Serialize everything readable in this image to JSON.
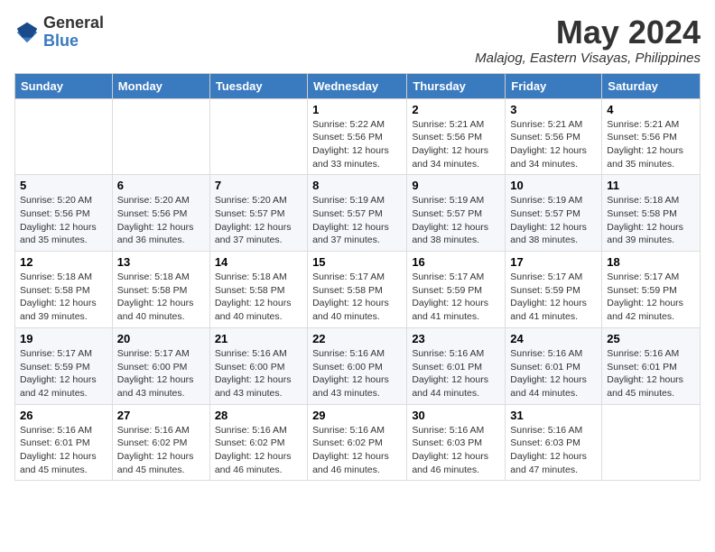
{
  "logo": {
    "general": "General",
    "blue": "Blue"
  },
  "title": {
    "month": "May 2024",
    "location": "Malajog, Eastern Visayas, Philippines"
  },
  "days_of_week": [
    "Sunday",
    "Monday",
    "Tuesday",
    "Wednesday",
    "Thursday",
    "Friday",
    "Saturday"
  ],
  "weeks": [
    [
      {
        "day": "",
        "info": ""
      },
      {
        "day": "",
        "info": ""
      },
      {
        "day": "",
        "info": ""
      },
      {
        "day": "1",
        "info": "Sunrise: 5:22 AM\nSunset: 5:56 PM\nDaylight: 12 hours\nand 33 minutes."
      },
      {
        "day": "2",
        "info": "Sunrise: 5:21 AM\nSunset: 5:56 PM\nDaylight: 12 hours\nand 34 minutes."
      },
      {
        "day": "3",
        "info": "Sunrise: 5:21 AM\nSunset: 5:56 PM\nDaylight: 12 hours\nand 34 minutes."
      },
      {
        "day": "4",
        "info": "Sunrise: 5:21 AM\nSunset: 5:56 PM\nDaylight: 12 hours\nand 35 minutes."
      }
    ],
    [
      {
        "day": "5",
        "info": "Sunrise: 5:20 AM\nSunset: 5:56 PM\nDaylight: 12 hours\nand 35 minutes."
      },
      {
        "day": "6",
        "info": "Sunrise: 5:20 AM\nSunset: 5:56 PM\nDaylight: 12 hours\nand 36 minutes."
      },
      {
        "day": "7",
        "info": "Sunrise: 5:20 AM\nSunset: 5:57 PM\nDaylight: 12 hours\nand 37 minutes."
      },
      {
        "day": "8",
        "info": "Sunrise: 5:19 AM\nSunset: 5:57 PM\nDaylight: 12 hours\nand 37 minutes."
      },
      {
        "day": "9",
        "info": "Sunrise: 5:19 AM\nSunset: 5:57 PM\nDaylight: 12 hours\nand 38 minutes."
      },
      {
        "day": "10",
        "info": "Sunrise: 5:19 AM\nSunset: 5:57 PM\nDaylight: 12 hours\nand 38 minutes."
      },
      {
        "day": "11",
        "info": "Sunrise: 5:18 AM\nSunset: 5:58 PM\nDaylight: 12 hours\nand 39 minutes."
      }
    ],
    [
      {
        "day": "12",
        "info": "Sunrise: 5:18 AM\nSunset: 5:58 PM\nDaylight: 12 hours\nand 39 minutes."
      },
      {
        "day": "13",
        "info": "Sunrise: 5:18 AM\nSunset: 5:58 PM\nDaylight: 12 hours\nand 40 minutes."
      },
      {
        "day": "14",
        "info": "Sunrise: 5:18 AM\nSunset: 5:58 PM\nDaylight: 12 hours\nand 40 minutes."
      },
      {
        "day": "15",
        "info": "Sunrise: 5:17 AM\nSunset: 5:58 PM\nDaylight: 12 hours\nand 40 minutes."
      },
      {
        "day": "16",
        "info": "Sunrise: 5:17 AM\nSunset: 5:59 PM\nDaylight: 12 hours\nand 41 minutes."
      },
      {
        "day": "17",
        "info": "Sunrise: 5:17 AM\nSunset: 5:59 PM\nDaylight: 12 hours\nand 41 minutes."
      },
      {
        "day": "18",
        "info": "Sunrise: 5:17 AM\nSunset: 5:59 PM\nDaylight: 12 hours\nand 42 minutes."
      }
    ],
    [
      {
        "day": "19",
        "info": "Sunrise: 5:17 AM\nSunset: 5:59 PM\nDaylight: 12 hours\nand 42 minutes."
      },
      {
        "day": "20",
        "info": "Sunrise: 5:17 AM\nSunset: 6:00 PM\nDaylight: 12 hours\nand 43 minutes."
      },
      {
        "day": "21",
        "info": "Sunrise: 5:16 AM\nSunset: 6:00 PM\nDaylight: 12 hours\nand 43 minutes."
      },
      {
        "day": "22",
        "info": "Sunrise: 5:16 AM\nSunset: 6:00 PM\nDaylight: 12 hours\nand 43 minutes."
      },
      {
        "day": "23",
        "info": "Sunrise: 5:16 AM\nSunset: 6:01 PM\nDaylight: 12 hours\nand 44 minutes."
      },
      {
        "day": "24",
        "info": "Sunrise: 5:16 AM\nSunset: 6:01 PM\nDaylight: 12 hours\nand 44 minutes."
      },
      {
        "day": "25",
        "info": "Sunrise: 5:16 AM\nSunset: 6:01 PM\nDaylight: 12 hours\nand 45 minutes."
      }
    ],
    [
      {
        "day": "26",
        "info": "Sunrise: 5:16 AM\nSunset: 6:01 PM\nDaylight: 12 hours\nand 45 minutes."
      },
      {
        "day": "27",
        "info": "Sunrise: 5:16 AM\nSunset: 6:02 PM\nDaylight: 12 hours\nand 45 minutes."
      },
      {
        "day": "28",
        "info": "Sunrise: 5:16 AM\nSunset: 6:02 PM\nDaylight: 12 hours\nand 46 minutes."
      },
      {
        "day": "29",
        "info": "Sunrise: 5:16 AM\nSunset: 6:02 PM\nDaylight: 12 hours\nand 46 minutes."
      },
      {
        "day": "30",
        "info": "Sunrise: 5:16 AM\nSunset: 6:03 PM\nDaylight: 12 hours\nand 46 minutes."
      },
      {
        "day": "31",
        "info": "Sunrise: 5:16 AM\nSunset: 6:03 PM\nDaylight: 12 hours\nand 47 minutes."
      },
      {
        "day": "",
        "info": ""
      }
    ]
  ]
}
